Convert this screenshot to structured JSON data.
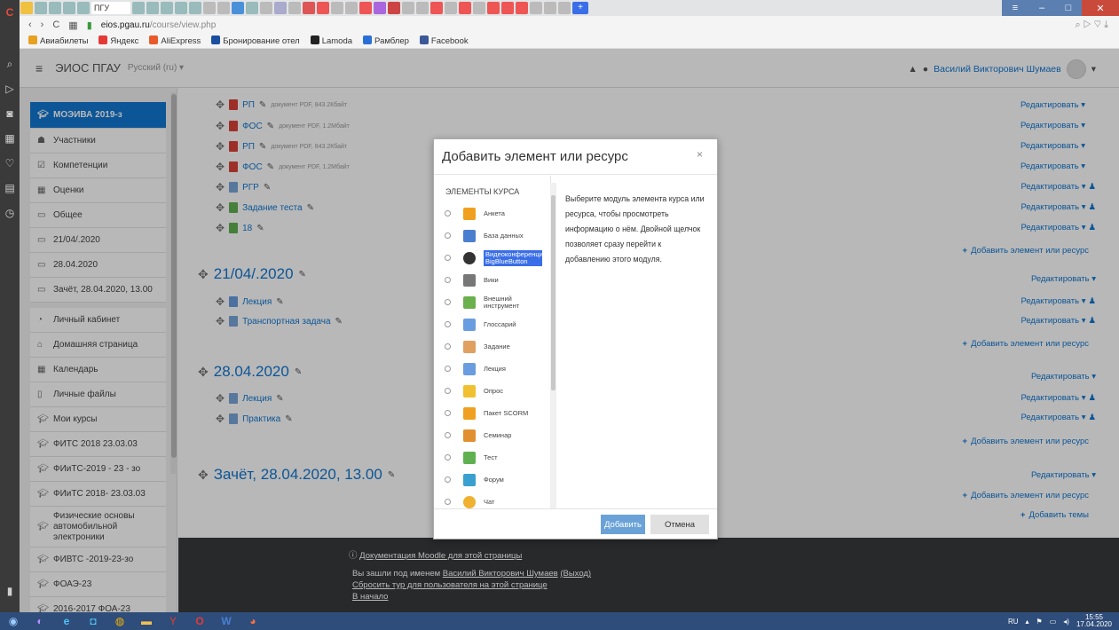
{
  "browser": {
    "active_tab_label": "ПГУ",
    "url_host": "eios.pgau.ru",
    "url_path": "/course/view.php",
    "bookmarks": [
      "Авиабилеты",
      "Яндекс",
      "AliExpress",
      "Бронирование отел",
      "Lamoda",
      "Рамблер",
      "Facebook"
    ]
  },
  "navbar": {
    "site_name": "ЭИОС ПГАУ",
    "language": "Русский (ru) ▾",
    "user_name": "Василий Викторович Шумаев"
  },
  "drawer": {
    "items": [
      {
        "label": "МОЭИВА 2019-з",
        "icon": "hat-icon"
      },
      {
        "label": "Участники",
        "icon": "users-icon"
      },
      {
        "label": "Компетенции",
        "icon": "check-icon"
      },
      {
        "label": "Оценки",
        "icon": "table-icon"
      },
      {
        "label": "Общее",
        "icon": "folder-icon"
      },
      {
        "label": "21/04/.2020",
        "icon": "folder-icon"
      },
      {
        "label": "28.04.2020",
        "icon": "folder-icon"
      },
      {
        "label": "Зачёт, 28.04.2020, 13.00",
        "icon": "folder-icon"
      },
      {
        "label": "Личный кабинет",
        "icon": "dashboard-icon"
      },
      {
        "label": "Домашняя страница",
        "icon": "home-icon"
      },
      {
        "label": "Календарь",
        "icon": "calendar-icon"
      },
      {
        "label": "Личные файлы",
        "icon": "file-icon"
      },
      {
        "label": "Мои курсы",
        "icon": "hat-icon"
      },
      {
        "label": "ФИТС 2018 23.03.03",
        "icon": "hat-icon"
      },
      {
        "label": "ФИиТС-2019 - 23 - зо",
        "icon": "hat-icon"
      },
      {
        "label": "ФИиТС 2018- 23.03.03",
        "icon": "hat-icon"
      },
      {
        "label": "Физические основы автомобильной электроники",
        "icon": "hat-icon"
      },
      {
        "label": "ФИВТС -2019-23-зо",
        "icon": "hat-icon"
      },
      {
        "label": "ФОАЭ-23",
        "icon": "hat-icon"
      },
      {
        "label": "2016-2017 ФОА-23",
        "icon": "hat-icon"
      }
    ]
  },
  "general": {
    "resources": [
      {
        "name": "РП",
        "meta": "документ PDF, 843.2Кбайт"
      },
      {
        "name": "ФОС",
        "meta": "документ PDF, 1.2Мбайт"
      },
      {
        "name": "РП",
        "meta": "документ PDF, 843.2Кбайт"
      },
      {
        "name": "ФОС",
        "meta": "документ PDF, 1.2Мбайт"
      },
      {
        "name": "РГР",
        "meta": ""
      },
      {
        "name": "Задание теста",
        "meta": ""
      },
      {
        "name": "18",
        "meta": ""
      }
    ]
  },
  "sections": [
    {
      "title": "21/04/.2020",
      "items": [
        "Лекция",
        "Транспортная задача"
      ]
    },
    {
      "title": "28.04.2020",
      "items": [
        "Лекция",
        "Практика"
      ]
    },
    {
      "title": "Зачёт, 28.04.2020, 13.00",
      "items": []
    }
  ],
  "labels": {
    "edit": "Редактировать ▾",
    "add_activity": "Добавить элемент или ресурс",
    "add_sections": "Добавить темы"
  },
  "modal": {
    "title": "Добавить элемент или ресурс",
    "close": "×",
    "list_header": "ЭЛЕМЕНТЫ КУРСА",
    "options": [
      {
        "label": "Анкета",
        "color": "#f0a020"
      },
      {
        "label": "База данных",
        "color": "#4a7fd0"
      },
      {
        "label": "Видеоконференция BigBlueButton",
        "color": "#333333"
      },
      {
        "label": "Вики",
        "color": "#777777"
      },
      {
        "label": "Внешний инструмент",
        "color": "#6ab04c"
      },
      {
        "label": "Глоссарий",
        "color": "#6a9de0"
      },
      {
        "label": "Задание",
        "color": "#e0a060"
      },
      {
        "label": "Лекция",
        "color": "#6a9de0"
      },
      {
        "label": "Опрос",
        "color": "#f0c030"
      },
      {
        "label": "Пакет SCORM",
        "color": "#f0a020"
      },
      {
        "label": "Семинар",
        "color": "#e09030"
      },
      {
        "label": "Тест",
        "color": "#60b050"
      },
      {
        "label": "Форум",
        "color": "#3aa0d0"
      },
      {
        "label": "Чат",
        "color": "#f0b030"
      }
    ],
    "description": "Выберите модуль элемента курса или ресурса, чтобы просмотреть информацию о нём. Двойной щелчок позволяет сразу перейти к добавлению этого модуля.",
    "add_button": "Добавить",
    "cancel_button": "Отмена"
  },
  "footer": {
    "docs_link": "Документация Moodle для этой страницы",
    "logged_prefix": "Вы зашли под именем",
    "logged_user": "Василий Викторович Шумаев",
    "logout": "(Выход)",
    "reset_tour": "Сбросить тур для пользователя на этой странице",
    "home": "В начало"
  },
  "taskbar": {
    "lang": "RU",
    "time": "15:55",
    "date": "17.04.2020"
  },
  "colors": {
    "moodle_blue": "#1177d1",
    "pdf_red": "#d9433a"
  }
}
